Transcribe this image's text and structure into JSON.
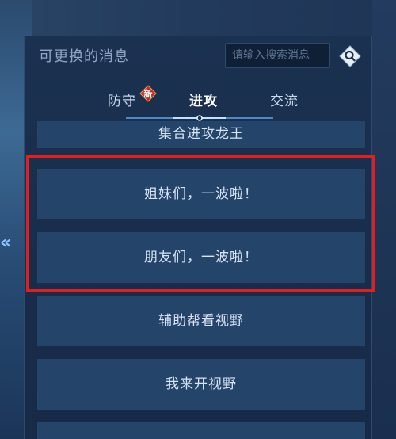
{
  "panel": {
    "title": "可更换的消息"
  },
  "search": {
    "placeholder": "请输入搜索消息"
  },
  "icons": {
    "search": "search-icon",
    "new_badge": "new-badge-icon",
    "side_arrow": "double-chevron-left-icon"
  },
  "tabs": [
    {
      "label": "防守",
      "active": false,
      "badge": "新"
    },
    {
      "label": "进攻",
      "active": true
    },
    {
      "label": "交流",
      "active": false
    }
  ],
  "messages": [
    {
      "text": "集合进攻龙王"
    },
    {
      "text": "姐妹们，一波啦！"
    },
    {
      "text": "朋友们，一波啦！"
    },
    {
      "text": "辅助帮看视野"
    },
    {
      "text": "我来开视野"
    },
    {
      "text": ""
    }
  ],
  "colors": {
    "highlight": "#e02020",
    "item_bg": "#24446a",
    "badge_red": "#c8281e"
  }
}
